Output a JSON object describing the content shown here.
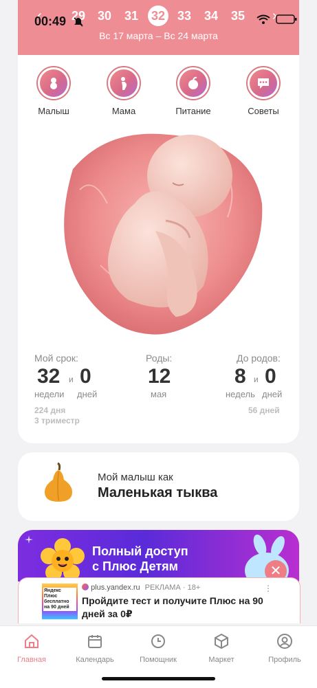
{
  "status_bar": {
    "time": "00:49"
  },
  "header": {
    "weeks": [
      "29",
      "30",
      "31",
      "32",
      "33",
      "34",
      "35"
    ],
    "active_week": "32",
    "prev_arrow": "‹",
    "next_arrow": "›",
    "date_range": "Вс 17 марта – Вс 24 марта"
  },
  "categories": [
    {
      "label": "Малыш",
      "icon": "baby-icon"
    },
    {
      "label": "Мама",
      "icon": "pregnant-mother-icon"
    },
    {
      "label": "Питание",
      "icon": "apple-icon"
    },
    {
      "label": "Советы",
      "icon": "chat-bubble-icon"
    }
  ],
  "stats": {
    "term": {
      "label": "Мой срок:",
      "weeks_value": "32",
      "weeks_unit": "недели",
      "conj": "и",
      "days_value": "0",
      "days_unit": "дней",
      "total_days": "224 дня",
      "trimester": "3 триместр"
    },
    "birth": {
      "label": "Роды:",
      "day": "12",
      "month": "мая"
    },
    "remaining": {
      "label": "До родов:",
      "weeks_value": "8",
      "weeks_unit": "недель",
      "conj": "и",
      "days_value": "0",
      "days_unit": "дней",
      "total_days": "56 дней"
    }
  },
  "fruit": {
    "pre": "Мой малыш как",
    "name": "Маленькая тыква"
  },
  "promo": {
    "line1": "Полный доступ",
    "line2": "с Плюс Детям",
    "close": "✕"
  },
  "ad": {
    "image_text": "Яндекс Плюс бесплатно на 90 дней",
    "domain": "plus.yandex.ru",
    "label": "РЕКЛАМА",
    "age": "18+",
    "title": "Пройдите тест и получите Плюс на 90 дней за 0₽",
    "menu": "⋮"
  },
  "nav": [
    {
      "label": "Главная",
      "icon": "home-icon",
      "active": true
    },
    {
      "label": "Календарь",
      "icon": "calendar-icon",
      "active": false
    },
    {
      "label": "Помощник",
      "icon": "clock-icon",
      "active": false
    },
    {
      "label": "Маркет",
      "icon": "box-icon",
      "active": false
    },
    {
      "label": "Профиль",
      "icon": "profile-icon",
      "active": false
    }
  ],
  "colors": {
    "accent": "#ef8d95",
    "promo_purple": "#6a2be0",
    "text": "#333333"
  }
}
